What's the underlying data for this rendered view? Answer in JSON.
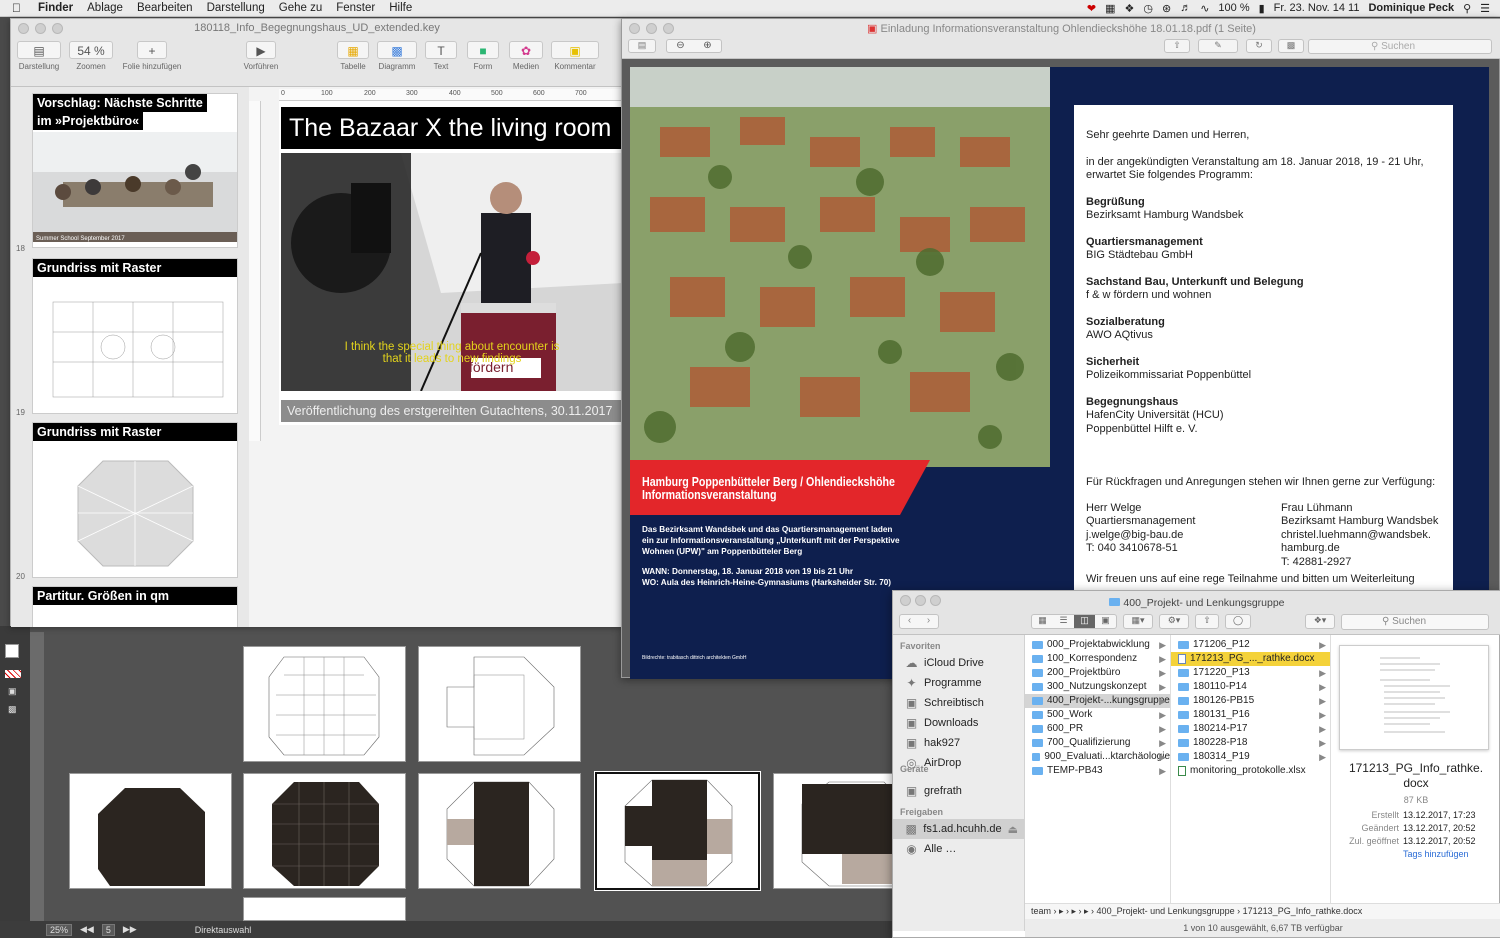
{
  "menubar": {
    "app": "Finder",
    "items": [
      "Ablage",
      "Bearbeiten",
      "Darstellung",
      "Gehe zu",
      "Fenster",
      "Hilfe"
    ],
    "battery": "100 %",
    "clock": "Fr. 23. Nov.  14 11",
    "user": "Dominique Peck"
  },
  "keynote": {
    "title": "180118_Info_Begegnungshaus_UD_extended.key",
    "toolbar": {
      "darstellung": "Darstellung",
      "zoom_value": "54 %",
      "zoomen": "Zoomen",
      "folie": "Folie hinzufügen",
      "vorfuehren": "Vorführen",
      "tabelle": "Tabelle",
      "diagramm": "Diagramm",
      "text": "Text",
      "form": "Form",
      "medien": "Medien",
      "kommentar": "Kommentar"
    },
    "ruler": [
      "0",
      "100",
      "200",
      "300",
      "400",
      "500",
      "600",
      "700"
    ],
    "slides": [
      {
        "num": "18",
        "title1": "Vorschlag: Nächste Schritte",
        "title2": "im »Projektbüro«",
        "caption": "Summer School September 2017"
      },
      {
        "num": "19",
        "title1": "Grundriss mit Raster"
      },
      {
        "num": "20",
        "title1": "Grundriss mit Raster"
      },
      {
        "num": "",
        "title1": "Partitur. Größen in qm"
      }
    ],
    "current_slide": {
      "title": "The Bazaar X the living room",
      "subtitle_1": "I think the special thing about encounter is",
      "subtitle_2": "that it leads to new findings",
      "lectern_text": "fördern",
      "caption": "Veröffentlichung des erstgereihten Gutachtens, 30.11.2017"
    }
  },
  "preview": {
    "title": "Einladung Informationsveranstaltung Ohlendieckshöhe 18.01.18.pdf (1 Seite)",
    "search_placeholder": "Suchen",
    "banner_1": "Hamburg Poppenbütteler Berg / Ohlendieckshöhe",
    "banner_2": "Informationsveranstaltung",
    "intro_1": "Das Bezirksamt Wandsbek und das Quartiersmanagement laden",
    "intro_2": "ein zur Informationsveranstaltung „Unterkunft mit der Perspektive",
    "intro_3": "Wohnen (UPW)\" am Poppenbütteler Berg",
    "wann": "WANN:  Donnerstag, 18. Januar 2018 von 19 bis 21 Uhr",
    "wo": "WO:       Aula des Heinrich-Heine-Gymnasiums (Harksheider Str. 70)",
    "credit": "Bildrechte: trabitasch dittrich architekten GmbH",
    "letter": {
      "greeting": "Sehr geehrte Damen und Herren,",
      "intro_1": "in der angekündigten Veranstaltung am 18. Januar 2018, 19 - 21 Uhr,",
      "intro_2": "erwartet Sie folgendes Programm:",
      "program": [
        {
          "heading": "Begrüßung",
          "lines": [
            "Bezirksamt Hamburg Wandsbek"
          ]
        },
        {
          "heading": "Quartiersmanagement",
          "lines": [
            "BIG Städtebau GmbH"
          ]
        },
        {
          "heading": "Sachstand Bau, Unterkunft und Belegung",
          "lines": [
            "f & w fördern und wohnen"
          ]
        },
        {
          "heading": "Sozialberatung",
          "lines": [
            "AWO AQtivus"
          ]
        },
        {
          "heading": "Sicherheit",
          "lines": [
            "Polizeikommissariat Poppenbüttel"
          ]
        },
        {
          "heading": "Begegnungshaus",
          "lines": [
            "HafenCity Universität (HCU)",
            "Poppenbüttel Hilft e. V."
          ]
        }
      ],
      "questions": "Für Rückfragen und Anregungen stehen wir Ihnen gerne zur Verfügung:",
      "contact_left": [
        "Herr Welge",
        "Quartiersmanagement",
        "j.welge@big-bau.de",
        "T: 040 3410678-51"
      ],
      "contact_right": [
        "Frau Lühmann",
        "Bezirksamt Hamburg Wandsbek",
        "christel.luehmann@wandsbek.",
        "hamburg.de",
        "T: 42881-2927"
      ],
      "closing": "Wir freuen uns auf eine rege Teilnahme und bitten um Weiterleitung"
    }
  },
  "finder": {
    "title": "400_Projekt- und Lenkungsgruppe",
    "search_placeholder": "Suchen",
    "sidebar_fav_header": "Favoriten",
    "sidebar_fav": [
      {
        "label": "iCloud Drive",
        "icon": "cloud-icon"
      },
      {
        "label": "Programme",
        "icon": "apps-icon"
      },
      {
        "label": "Schreibtisch",
        "icon": "folder-icon"
      },
      {
        "label": "Downloads",
        "icon": "folder-icon"
      },
      {
        "label": "hak927",
        "icon": "folder-icon"
      },
      {
        "label": "AirDrop",
        "icon": "airdrop-icon"
      },
      {
        "label": "grefrath",
        "icon": "folder-icon"
      }
    ],
    "sidebar_dev_header": "Geräte",
    "sidebar_share_header": "Freigaben",
    "sidebar_share": [
      {
        "label": "fs1.ad.hcuhh.de",
        "icon": "server-icon"
      },
      {
        "label": "Alle …",
        "icon": "network-icon"
      }
    ],
    "col1": [
      "000_Projektabwicklung",
      "100_Korrespondenz",
      "200_Projektbüro",
      "300_Nutzungskonzept",
      "400_Projekt-...kungsgruppe",
      "500_Work",
      "600_PR",
      "700_Qualifizierung",
      "900_Evaluati...ktarchäologie",
      "TEMP-PB43"
    ],
    "col2": [
      "171206_P12",
      "171213_PG_..._rathke.docx",
      "171220_P13",
      "180110-P14",
      "180126-PB15",
      "180131_P16",
      "180214-P17",
      "180228-P18",
      "180314_P19",
      "monitoring_protokolle.xlsx"
    ],
    "preview_name_1": "171213_PG_Info_rathke.",
    "preview_name_2": "docx",
    "preview_size": "87 KB",
    "meta": [
      {
        "label": "Erstellt",
        "value": "13.12.2017, 17:23"
      },
      {
        "label": "Geändert",
        "value": "13.12.2017, 20:52"
      },
      {
        "label": "Zul. geöffnet",
        "value": "13.12.2017, 20:52"
      }
    ],
    "tags_link": "Tags hinzufügen",
    "path": "team › ▸ › ▸ › ▸ › 400_Projekt- und Lenkungsgruppe › 171213_PG_Info_rathke.docx",
    "status": "1 von 10 ausgewählt, 6,67 TB verfügbar"
  },
  "indesign": {
    "zoom": "25%",
    "page": "5",
    "mode": "Direktauswahl"
  }
}
